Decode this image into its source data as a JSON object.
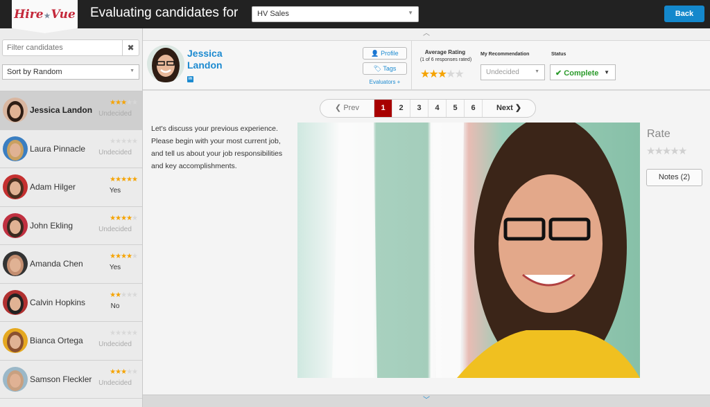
{
  "topbar": {
    "logo_left": "Hire",
    "logo_right": "Vue",
    "title": "Evaluating candidates for",
    "job_select_value": "HV Sales",
    "back_label": "Back"
  },
  "sidebar": {
    "filter_placeholder": "Filter candidates",
    "sort_value": "Sort by Random",
    "candidates": [
      {
        "name": "Jessica Landon",
        "rating": 3,
        "recommendation": "Undecided",
        "active": true
      },
      {
        "name": "Laura Pinnacle",
        "rating": 0,
        "recommendation": "Undecided"
      },
      {
        "name": "Adam Hilger",
        "rating": 5,
        "recommendation": "Yes"
      },
      {
        "name": "John Ekling",
        "rating": 4,
        "recommendation": "Undecided"
      },
      {
        "name": "Amanda Chen",
        "rating": 4,
        "recommendation": "Yes"
      },
      {
        "name": "Calvin Hopkins",
        "rating": 1.5,
        "recommendation": "No"
      },
      {
        "name": "Bianca Ortega",
        "rating": 0,
        "recommendation": "Undecided"
      },
      {
        "name": "Samson Fleckler",
        "rating": 3,
        "recommendation": "Undecided"
      }
    ]
  },
  "header": {
    "first_name": "Jessica",
    "last_name": "Landon",
    "linkedin_icon": "in",
    "profile_label": "Profile",
    "tags_label": "Tags",
    "evaluators_label": "Evaluators +",
    "average_rating_label": "Average Rating",
    "average_rating_sub": "(1 of 6 responses rated)",
    "average_rating": 3,
    "my_recommendation_label": "My Recommendation",
    "my_recommendation_value": "Undecided",
    "status_label": "Status",
    "status_value": "Complete"
  },
  "pager": {
    "prev_label": "Prev",
    "next_label": "Next",
    "pages": [
      "1",
      "2",
      "3",
      "4",
      "5",
      "6"
    ],
    "current": "1"
  },
  "question": "Let's discuss your previous experience. Please begin with your most current job, and tell us about your job responsibilities and key accomplishments.",
  "rate": {
    "label": "Rate",
    "value": 0,
    "notes_label": "Notes (2)"
  },
  "colors": {
    "accent": "#1c8ad0",
    "star": "#f5a300",
    "current_page": "#a80000",
    "status_green": "#2a9a2a",
    "back_button": "#1488cc"
  }
}
